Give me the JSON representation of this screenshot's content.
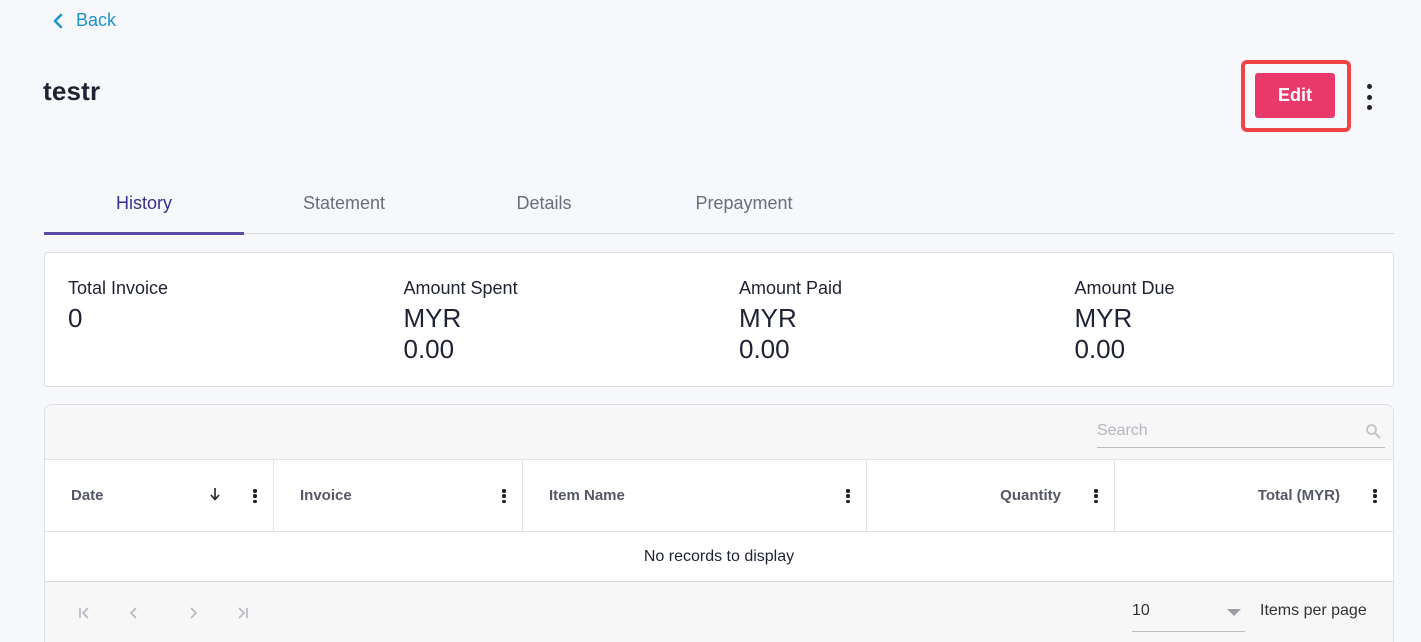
{
  "nav": {
    "back_label": "Back"
  },
  "page": {
    "title": "testr"
  },
  "actions": {
    "edit_label": "Edit"
  },
  "tabs": [
    {
      "label": "History",
      "active": true
    },
    {
      "label": "Statement",
      "active": false
    },
    {
      "label": "Details",
      "active": false
    },
    {
      "label": "Prepayment",
      "active": false
    }
  ],
  "summary": [
    {
      "label": "Total Invoice",
      "value_line1": "0",
      "value_line2": ""
    },
    {
      "label": "Amount Spent",
      "value_line1": "MYR",
      "value_line2": "0.00"
    },
    {
      "label": "Amount Paid",
      "value_line1": "MYR",
      "value_line2": "0.00"
    },
    {
      "label": "Amount Due",
      "value_line1": "MYR",
      "value_line2": "0.00"
    }
  ],
  "grid": {
    "search_placeholder": "Search",
    "columns": [
      {
        "label": "Date",
        "sorted": "descending"
      },
      {
        "label": "Invoice"
      },
      {
        "label": "Item Name"
      },
      {
        "label": "Quantity"
      },
      {
        "label": "Total (MYR)"
      }
    ],
    "empty_message": "No records to display",
    "pager": {
      "page_size": "10",
      "items_per_page_label": "Items per page"
    }
  },
  "colors": {
    "accent_link": "#1e94cc",
    "edit_button": "#e8396a",
    "highlight_border": "#ef4444",
    "active_tab": "#5b4aa8"
  },
  "icons": {
    "back": "chevron-left-icon",
    "more": "kebab-menu-icon",
    "search": "search-icon",
    "sort": "arrow-down-icon",
    "pager_first": "page-first-icon",
    "pager_prev": "chevron-left-icon",
    "pager_next": "chevron-right-icon",
    "pager_last": "page-last-icon",
    "dropdown": "caret-down-icon"
  }
}
